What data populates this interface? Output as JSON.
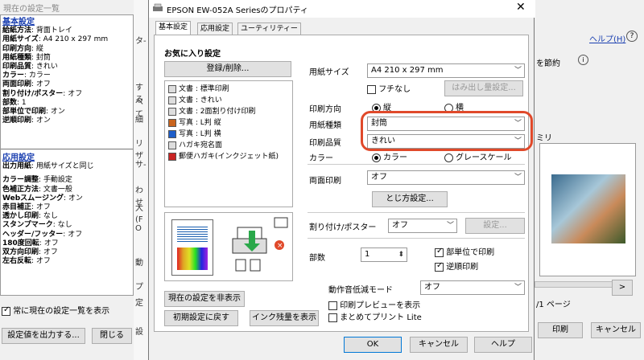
{
  "left_panel": {
    "title": "現在の設定一覧",
    "lines": [
      {
        "text": "基本設定",
        "head": true
      },
      {
        "label": "給紙方法",
        "value": ": 背面トレイ"
      },
      {
        "label": "用紙サイズ",
        "value": ": A4 210 x 297 mm"
      },
      {
        "label": "印刷方向",
        "value": ": 縦"
      },
      {
        "label": "用紙種類",
        "value": ": 封筒"
      },
      {
        "label": "印刷品質",
        "value": ": きれい"
      },
      {
        "label": "カラー",
        "value": ": カラー"
      },
      {
        "label": "両面印刷",
        "value": ": オフ"
      },
      {
        "label": "割り付け/ポスター",
        "value": ": オフ"
      },
      {
        "label": "部数",
        "value": ": 1"
      },
      {
        "label": "部単位で印刷",
        "value": ": オン"
      },
      {
        "label": "逆順印刷",
        "value": ": オン"
      },
      {
        "text": "応用設定",
        "head": true
      },
      {
        "label": "出力用紙",
        "value": ": 用紙サイズと同じ"
      },
      {
        "label": "カラー調整",
        "value": ": 手動設定"
      },
      {
        "label": "色補正方法",
        "value": ": 文書一般"
      },
      {
        "label": "Webスムージング",
        "value": ": オン"
      },
      {
        "label": "赤目補正",
        "value": ": オフ"
      },
      {
        "label": "透かし印刷",
        "value": ": なし"
      },
      {
        "label": "スタンプマーク",
        "value": ": なし"
      },
      {
        "label": "ヘッダー/フッター",
        "value": ": オフ"
      },
      {
        "label": "180度回転",
        "value": ": オフ"
      },
      {
        "label": "双方向印刷",
        "value": ": オフ"
      },
      {
        "label": "左右反転",
        "value": ": オフ"
      }
    ],
    "always_show_label": "常に現在の設定一覧を表示",
    "export_button": "設定値を出力する...",
    "close_button": "閉じる"
  },
  "mid_strip": [
    "タ-",
    "する",
    "べて",
    "細",
    "リザ",
    "サ-",
    "わせ",
    "大",
    "(F O",
    "動",
    "プ",
    "定",
    "設"
  ],
  "right_bg": {
    "help_link": "ヘルプ(H)",
    "save_label": "を節約",
    "paper_label": "ミリ",
    "next_button": ">",
    "page_label": "/1 ページ",
    "print_button": "印刷",
    "cancel_button": "キャンセル"
  },
  "dialog": {
    "title": "EPSON EW-052A Seriesのプロパティ",
    "tabs": [
      "基本設定",
      "応用設定",
      "ユーティリティー"
    ],
    "favorites_label": "お気に入り設定",
    "register_button": "登録/削除...",
    "favorites": [
      "文書 : 標準印刷",
      "文書 : きれい",
      "文書 : 2面割り付け印刷",
      "写真 : L判 縦",
      "写真 : L判 横",
      "ハガキ宛名面",
      "郵便ハガキ(インクジェット紙)"
    ],
    "paper_size_label": "用紙サイズ",
    "paper_size_value": "A4 210 x 297 mm",
    "borderless_label": "フチなし",
    "overflow_button": "はみ出し量設定...",
    "orientation_label": "印刷方向",
    "orient_portrait": "縦",
    "orient_landscape": "横",
    "paper_type_label": "用紙種類",
    "paper_type_value": "封筒",
    "quality_label": "印刷品質",
    "quality_value": "きれい",
    "color_label": "カラー",
    "color_color": "カラー",
    "color_gray": "グレースケール",
    "duplex_label": "両面印刷",
    "duplex_value": "オフ",
    "binding_button": "とじ方設定...",
    "multipage_label": "割り付け/ポスター",
    "multipage_value": "オフ",
    "settings_button": "設定...",
    "copies_label": "部数",
    "copies_value": "1",
    "collate_label": "部単位で印刷",
    "reverse_label": "逆順印刷",
    "quiet_label": "動作音低減モード",
    "quiet_value": "オフ",
    "preview_label": "印刷プレビューを表示",
    "lite_label": "まとめてプリント Lite",
    "hide_settings_button": "現在の設定を非表示",
    "reset_button": "初期設定に戻す",
    "ink_button": "インク残量を表示",
    "ok_button": "OK",
    "cancel_button": "キャンセル",
    "help_button": "ヘルプ"
  },
  "colors": {
    "highlight": "#e0492a",
    "link": "#1a3fb0"
  }
}
